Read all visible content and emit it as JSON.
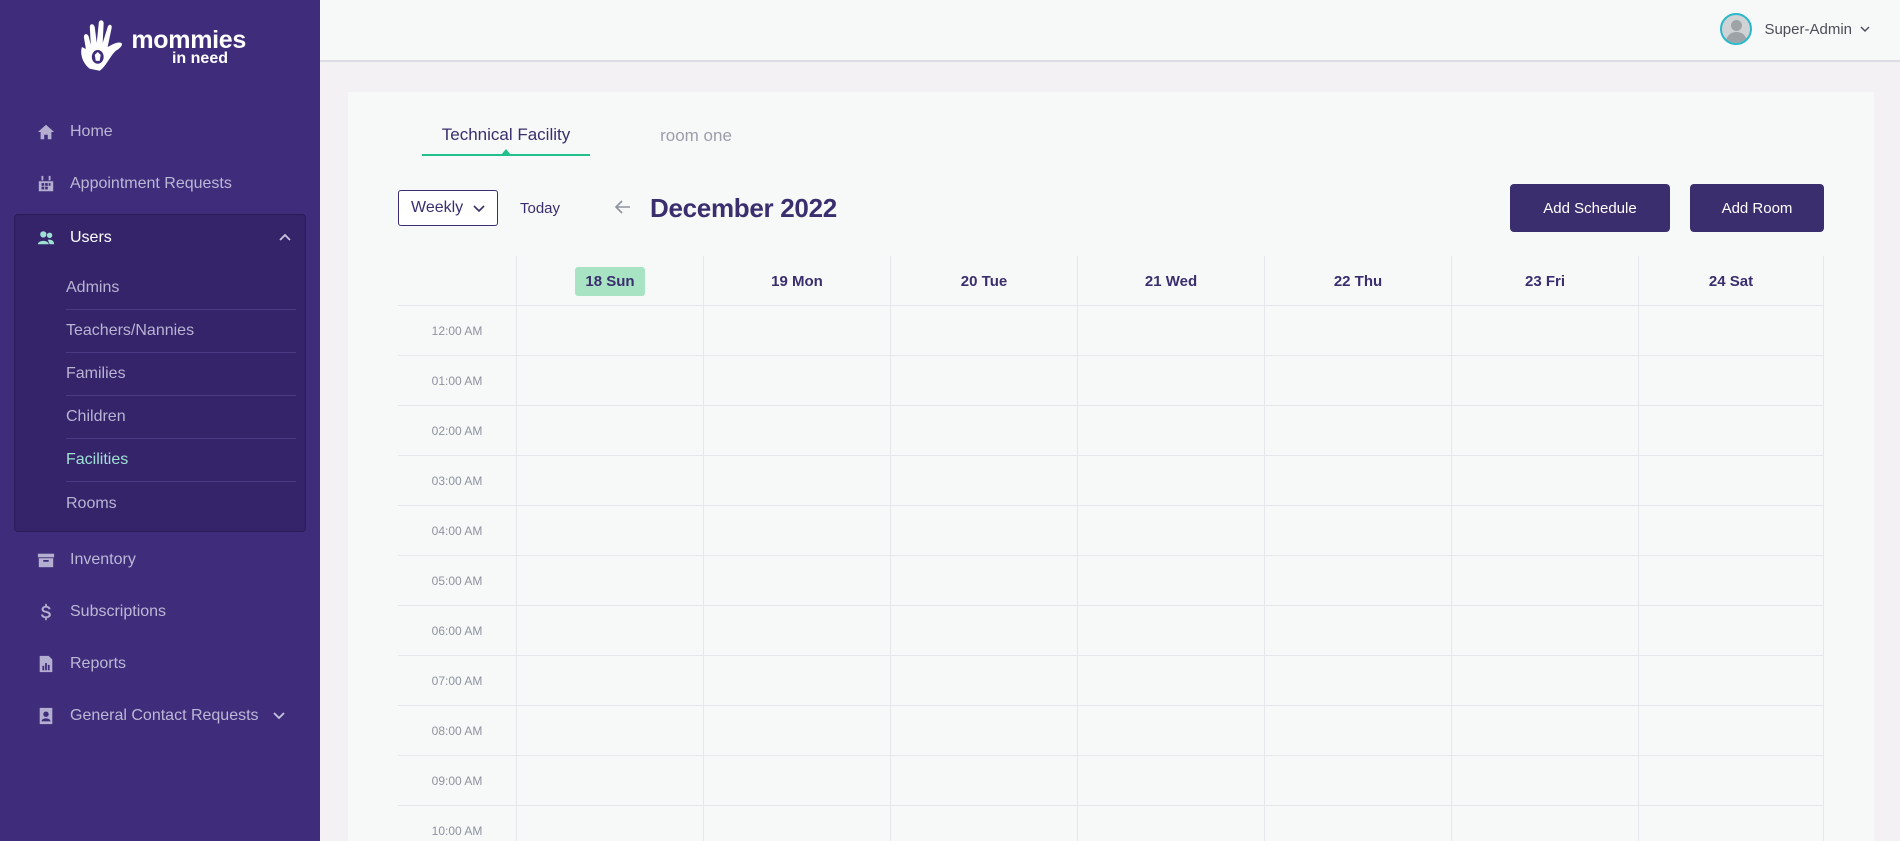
{
  "brand": {
    "name_line1": "mommies",
    "name_line2": "in need"
  },
  "sidebar": {
    "top_items": [
      {
        "label": "Home",
        "icon": "home-icon"
      },
      {
        "label": "Appointment Requests",
        "icon": "calendar-icon"
      }
    ],
    "users_group": {
      "label": "Users",
      "icon": "users-icon",
      "expanded": true,
      "items": [
        {
          "label": "Admins"
        },
        {
          "label": "Teachers/Nannies"
        },
        {
          "label": "Families"
        },
        {
          "label": "Children"
        },
        {
          "label": "Facilities",
          "active": true
        },
        {
          "label": "Rooms"
        }
      ]
    },
    "bottom_items": [
      {
        "label": "Inventory",
        "icon": "archive-icon"
      },
      {
        "label": "Subscriptions",
        "icon": "dollar-icon"
      },
      {
        "label": "Reports",
        "icon": "report-icon"
      },
      {
        "label": "General Contact Requests",
        "icon": "contact-icon",
        "has_chevron": true
      }
    ]
  },
  "header": {
    "user_name": "Super-Admin"
  },
  "tabs": [
    {
      "label": "Technical Facility",
      "active": true
    },
    {
      "label": "room one",
      "active": false
    }
  ],
  "toolbar": {
    "view_select": "Weekly",
    "today_label": "Today",
    "month_title": "December 2022",
    "add_schedule_label": "Add Schedule",
    "add_room_label": "Add Room"
  },
  "calendar": {
    "days": [
      {
        "label": "18 Sun",
        "today": true
      },
      {
        "label": "19 Mon"
      },
      {
        "label": "20 Tue"
      },
      {
        "label": "21 Wed"
      },
      {
        "label": "22 Thu"
      },
      {
        "label": "23 Fri"
      },
      {
        "label": "24 Sat"
      }
    ],
    "times": [
      "12:00 AM",
      "01:00 AM",
      "02:00 AM",
      "03:00 AM",
      "04:00 AM",
      "05:00 AM",
      "06:00 AM",
      "07:00 AM",
      "08:00 AM",
      "09:00 AM",
      "10:00 AM"
    ]
  },
  "colors": {
    "sidebar_bg": "#3f2d7b",
    "primary": "#3a2e6e",
    "accent_green": "#22c08c",
    "today_badge": "#a8e4c4"
  }
}
